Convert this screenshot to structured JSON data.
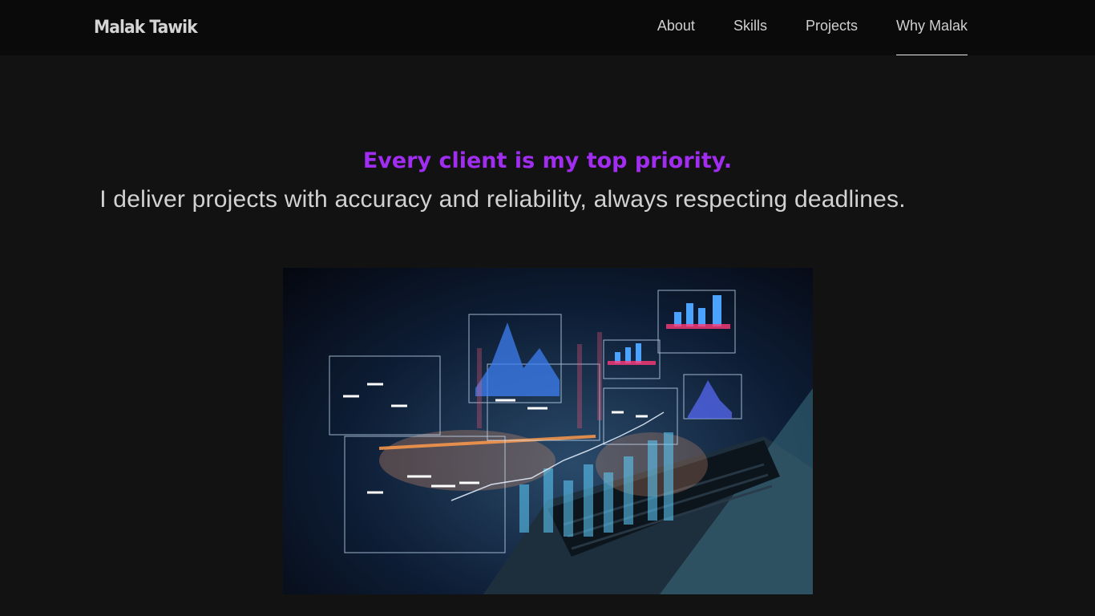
{
  "header": {
    "brand": "Malak Tawik",
    "nav": [
      {
        "label": "About"
      },
      {
        "label": "Skills"
      },
      {
        "label": "Projects"
      },
      {
        "label": "Why Malak",
        "active": true
      }
    ]
  },
  "hero": {
    "title": "Every client is my top priority.",
    "subtitle": "I deliver projects with accuracy and reliability, always respecting deadlines."
  },
  "image": {
    "icon": "analytics-dashboard-photo"
  },
  "colors": {
    "background": "#121212",
    "topbar": "#0a0a0a",
    "accent": "#a02df0"
  }
}
